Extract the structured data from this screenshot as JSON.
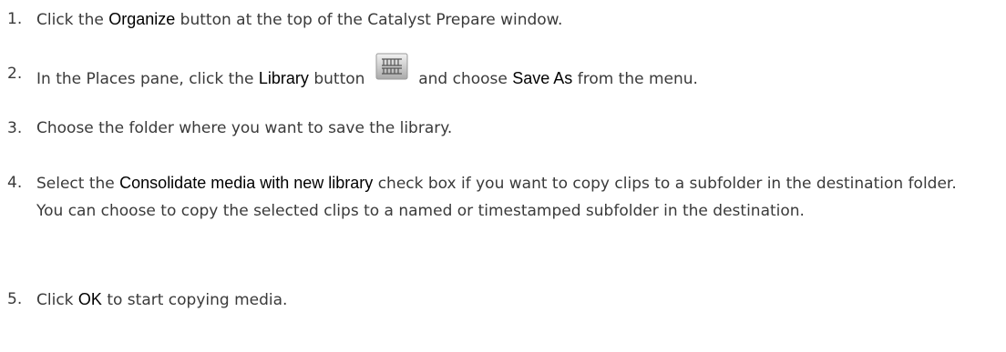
{
  "steps": [
    {
      "num": "1.",
      "parts": [
        "Click the ",
        "Organize",
        " button at the top of the Catalyst Prepare window."
      ]
    },
    {
      "num": "2.",
      "parts": [
        "In the Places pane, click the ",
        "Library",
        " button ",
        " and choose ",
        "Save As",
        " from the menu."
      ],
      "icon": "library-icon"
    },
    {
      "num": "3.",
      "parts": [
        "Choose the folder where you want to save the library."
      ]
    },
    {
      "num": "4.",
      "parts": [
        "Select the ",
        "Consolidate media with new library",
        " check box if you want to copy clips to a subfolder in the destination folder. You can choose to copy the selected clips to a named or timestamped subfolder in the destination."
      ]
    },
    {
      "num": "5.",
      "parts": [
        "Click ",
        "OK",
        " to start copying media."
      ]
    }
  ]
}
